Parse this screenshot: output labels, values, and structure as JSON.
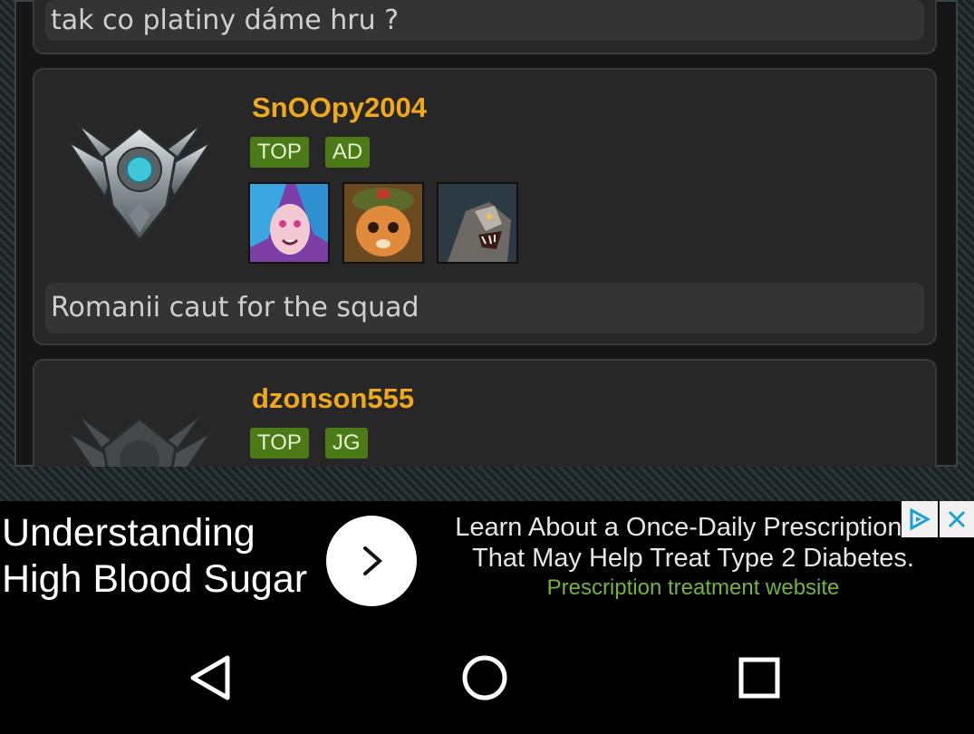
{
  "posts": [
    {
      "comment": "tak co platiny dáme hru ?"
    },
    {
      "username": "SnOOpy2004",
      "roles": [
        "TOP",
        "AD"
      ],
      "champions": [
        "jinx-portrait",
        "teemo-portrait",
        "rengar-portrait"
      ],
      "rank_icon": "silver-rank-emblem",
      "comment": "Romanii caut for the squad"
    },
    {
      "username": "dzonson555",
      "roles": [
        "TOP",
        "JG"
      ],
      "rank_icon": "silver-rank-emblem"
    }
  ],
  "ad": {
    "headline_line1": "Understanding",
    "headline_line2": "High Blood Sugar",
    "body_line1": "Learn About a Once-Daily Prescription ...",
    "body_line2": "That May Help Treat Type 2 Diabetes.",
    "source": "Prescription treatment website",
    "cta_icon": "chevron-right-icon",
    "choices_icon": "adchoices-icon",
    "close_icon": "close-icon"
  },
  "nav": {
    "back_icon": "back-triangle-icon",
    "home_icon": "home-circle-icon",
    "recents_icon": "recents-square-icon"
  },
  "colors": {
    "username": "#f0a81e",
    "tag_bg": "#4c7a16",
    "ad_source": "#74b33e",
    "card_bg": "#272727"
  }
}
